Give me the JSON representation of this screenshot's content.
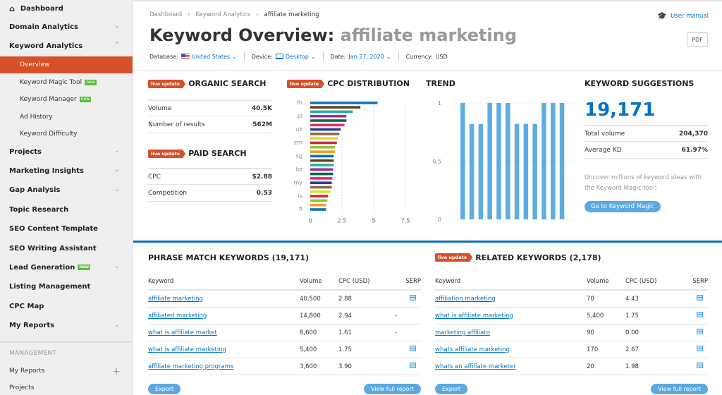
{
  "sidebar": {
    "dashboard": "Dashboard",
    "domain_analytics": "Domain Analytics",
    "keyword_analytics": "Keyword Analytics",
    "sub_items": [
      {
        "label": "Overview",
        "active": true,
        "badge": ""
      },
      {
        "label": "Keyword Magic Tool",
        "badge": "new"
      },
      {
        "label": "Keyword Manager",
        "badge": "new"
      },
      {
        "label": "Ad History",
        "badge": ""
      },
      {
        "label": "Keyword Difficulty",
        "badge": ""
      }
    ],
    "items": [
      {
        "label": "Projects",
        "chevron": true
      },
      {
        "label": "Marketing Insights",
        "chevron": true
      },
      {
        "label": "Gap Analysis",
        "chevron": true
      },
      {
        "label": "Topic Research",
        "chevron": false
      },
      {
        "label": "SEO Content Template",
        "chevron": false
      },
      {
        "label": "SEO Writing Assistant",
        "chevron": false
      },
      {
        "label": "Lead Generation",
        "chevron": true,
        "badge": "new"
      },
      {
        "label": "Listing Management",
        "chevron": false
      },
      {
        "label": "CPC Map",
        "chevron": false
      },
      {
        "label": "My Reports",
        "chevron": true
      }
    ],
    "management_label": "MANAGEMENT",
    "management_items": [
      "My Reports",
      "Projects"
    ]
  },
  "header": {
    "breadcrumb": [
      "Dashboard",
      "Keyword Analytics",
      "affiliate marketing"
    ],
    "user_manual": "User manual",
    "title_prefix": "Keyword Overview:",
    "title_keyword": "affiliate marketing",
    "pdf": "PDF",
    "database_label": "Database:",
    "database_value": "United States",
    "device_label": "Device:",
    "device_value": "Desktop",
    "date_label": "Date:",
    "date_value": "Jan 27, 2020",
    "currency_label": "Currency:",
    "currency_value": "USD"
  },
  "live_label": "live update",
  "organic": {
    "title": "ORGANIC SEARCH",
    "rows": [
      {
        "k": "Volume",
        "v": "40.5K"
      },
      {
        "k": "Number of results",
        "v": "562M"
      }
    ]
  },
  "paid": {
    "title": "PAID SEARCH",
    "rows": [
      {
        "k": "CPC",
        "v": "$2.88"
      },
      {
        "k": "Competition",
        "v": "0.53"
      }
    ]
  },
  "suggestions": {
    "title": "KEYWORD SUGGESTIONS",
    "count": "19,171",
    "rows": [
      {
        "k": "Total volume",
        "v": "204,370"
      },
      {
        "k": "Average KD",
        "v": "61.97%"
      }
    ],
    "text": "Uncover millions of keyword ideas with the Keyword Magic tool!",
    "button": "Go to Keyword Magic"
  },
  "chart_data": [
    {
      "type": "bar",
      "orientation": "horizontal",
      "title": "CPC DISTRIBUTION",
      "categories": [
        "th",
        "",
        "pl",
        "",
        "uk",
        "",
        "zm",
        "",
        "sg",
        "",
        "bz",
        "",
        "my",
        "",
        "is",
        "",
        "fi",
        ""
      ],
      "labels_shown": [
        "th",
        "pl",
        "uk",
        "zm",
        "sg",
        "bz",
        "my",
        "is",
        "fi"
      ],
      "values": [
        5.3,
        3.95,
        3.35,
        2.85,
        2.85,
        2.7,
        2.4,
        2.3,
        2.15,
        2.1,
        1.95,
        1.95,
        1.85,
        1.85,
        1.85,
        1.8,
        1.8,
        1.75,
        1.7,
        1.7,
        1.6,
        1.4,
        1.35,
        1.25,
        1.25
      ],
      "colors": [
        "#0a70c0",
        "#6b3f1e",
        "#1fb3a5",
        "#9b2f9e",
        "#0d6b3d",
        "#e8297a",
        "#2f3c8f",
        "#8c6a48",
        "#d8de2a",
        "#c9283a",
        "#8cc83e",
        "#f59b2a",
        "#0a70c0",
        "#6b3f1e",
        "#1fb3a5",
        "#9b2f9e",
        "#0d6b3d",
        "#e8297a",
        "#2f3c8f",
        "#8c6a48",
        "#d8de2a",
        "#c9283a",
        "#8cc83e",
        "#f59b2a",
        "#0a70c0"
      ],
      "xticks": [
        "0",
        "2.5",
        "5",
        "7.5"
      ],
      "xlim": [
        0,
        7.5
      ],
      "grid": true
    },
    {
      "type": "bar",
      "title": "TREND",
      "values": [
        1,
        0.82,
        0.82,
        1,
        1,
        1,
        0.82,
        0.82,
        0.82,
        1,
        1,
        1
      ],
      "yticks": [
        "0",
        "0.5",
        "1"
      ],
      "ylim": [
        0,
        1
      ],
      "color": "#5dade2",
      "grid": true
    }
  ],
  "phrase": {
    "title": "PHRASE MATCH KEYWORDS (19,171)",
    "headers": [
      "Keyword",
      "Volume",
      "CPC (USD)",
      "SERP"
    ],
    "rows": [
      {
        "kw": "affiliate marketing",
        "vol": "40,500",
        "cpc": "2.88",
        "serp": "icon"
      },
      {
        "kw": "affiliated marketing",
        "vol": "14,800",
        "cpc": "2.94",
        "serp": "-"
      },
      {
        "kw": "what is affiliate market",
        "vol": "6,600",
        "cpc": "1.61",
        "serp": "-"
      },
      {
        "kw": "what is affiliate marketing",
        "vol": "5,400",
        "cpc": "1.75",
        "serp": "icon"
      },
      {
        "kw": "affiliate marketing programs",
        "vol": "3,600",
        "cpc": "3.90",
        "serp": "icon"
      }
    ],
    "export": "Export",
    "view_full": "View full report"
  },
  "related": {
    "title": "RELATED KEYWORDS (2,178)",
    "headers": [
      "Keyword",
      "Volume",
      "CPC (USD)",
      "SERP"
    ],
    "rows": [
      {
        "kw": "affiliation marketing",
        "vol": "70",
        "cpc": "4.43",
        "serp": "icon"
      },
      {
        "kw": "what is affiliate marketing",
        "vol": "5,400",
        "cpc": "1.75",
        "serp": "icon"
      },
      {
        "kw": "marketing affiliato",
        "vol": "90",
        "cpc": "0.00",
        "serp": "icon"
      },
      {
        "kw": "whats affiliate marketing",
        "vol": "170",
        "cpc": "2.67",
        "serp": "icon"
      },
      {
        "kw": "whats an affiliate marketer",
        "vol": "20",
        "cpc": "1.98",
        "serp": "icon"
      }
    ],
    "export": "Export",
    "view_full": "View full report"
  }
}
